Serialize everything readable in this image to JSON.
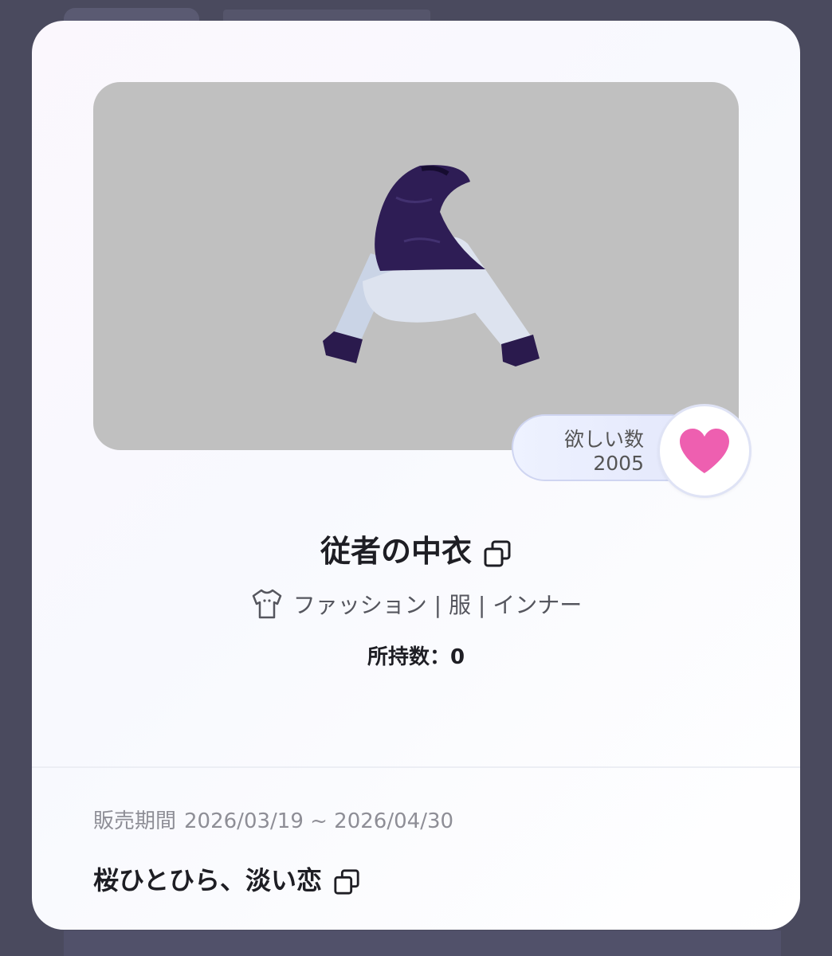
{
  "item": {
    "title": "従者の中衣",
    "category": "ファッション | 服 | インナー",
    "owned": "所持数：0"
  },
  "wish": {
    "label": "欲しい数",
    "count": "2005"
  },
  "sale": {
    "period_label": "販売期間",
    "period_value": "2026/03/19 ~ 2026/04/30",
    "event_title": "桜ひとひら、淡い恋"
  },
  "icons": {
    "wish": "heart-icon",
    "copy": "copy-icon",
    "category": "shirt-icon"
  },
  "colors": {
    "heart": "#ee5fb0",
    "image_bg": "#c0c0c0",
    "overlay": "#4a4a5e"
  }
}
